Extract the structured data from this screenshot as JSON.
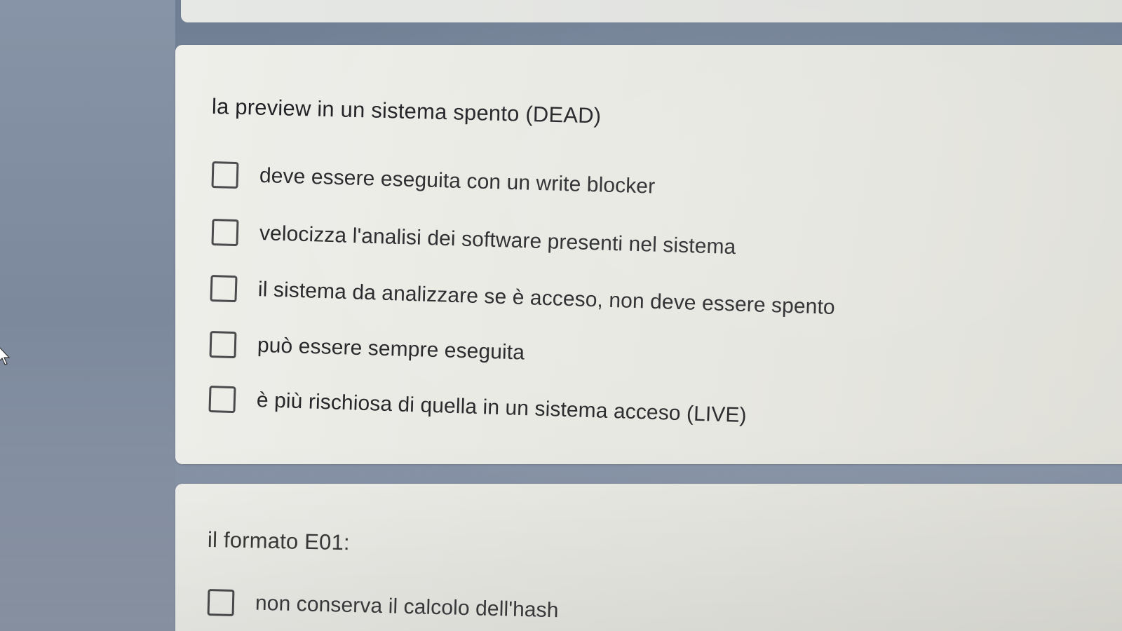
{
  "questions": [
    {
      "title": "la preview in un sistema spento (DEAD)",
      "options": [
        {
          "label": "deve essere eseguita con un write blocker",
          "checked": false
        },
        {
          "label": "velocizza l'analisi dei software presenti nel sistema",
          "checked": false
        },
        {
          "label": "il sistema da analizzare se è acceso, non deve essere spento",
          "checked": false
        },
        {
          "label": "può essere sempre eseguita",
          "checked": false
        },
        {
          "label": "è più rischiosa di quella in un sistema acceso (LIVE)",
          "checked": false
        }
      ]
    },
    {
      "title": "il formato E01:",
      "options": [
        {
          "label": "non conserva il calcolo dell'hash",
          "checked": false
        }
      ]
    }
  ],
  "colors": {
    "background": "#7d8aa0",
    "card": "#e9e9e4",
    "text": "#262729",
    "checkbox_border": "#4a4b4d"
  },
  "icons": {
    "cursor": "mouse-pointer-icon"
  }
}
